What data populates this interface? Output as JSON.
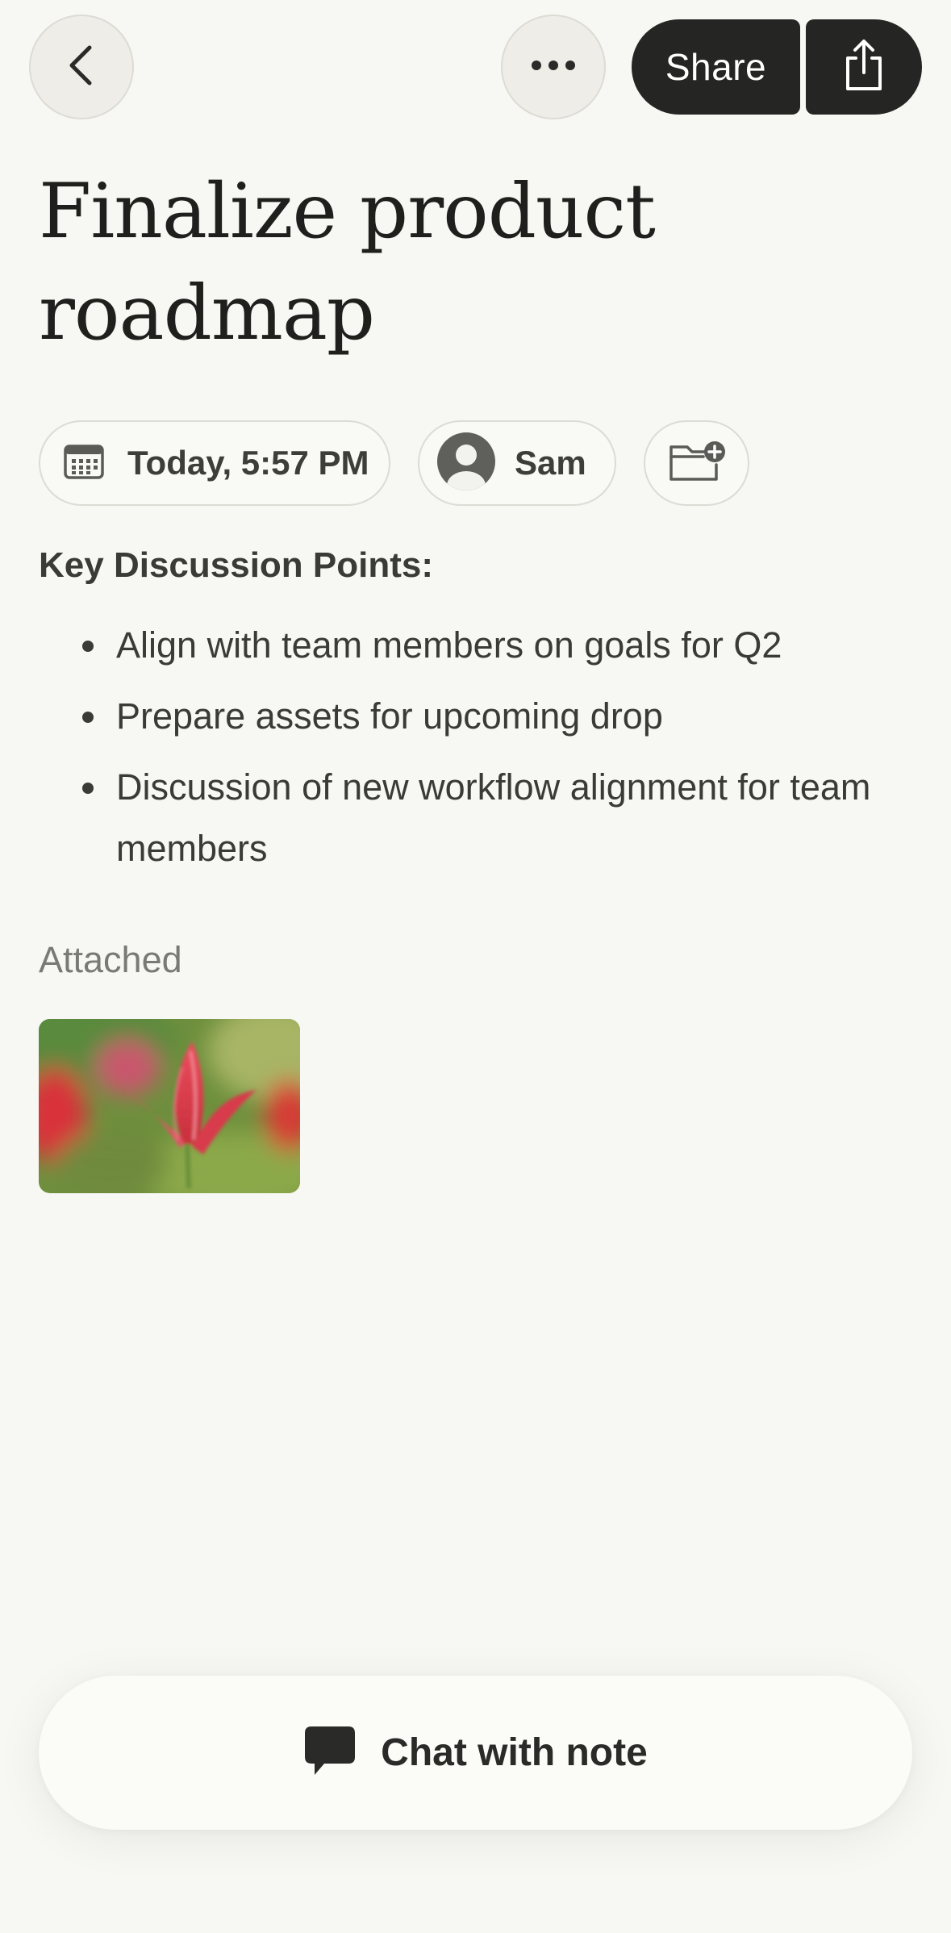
{
  "topbar": {
    "share_label": "Share"
  },
  "note": {
    "title": "Finalize product roadmap",
    "date_chip": "Today, 5:57 PM",
    "user_chip": "Sam",
    "section_heading": "Key Discussion Points:",
    "bullets": [
      "Align with team members on goals for Q2",
      "Prepare assets for upcoming drop",
      "Discussion of new workflow alignment for team members"
    ],
    "attached_label": "Attached"
  },
  "chat": {
    "label": "Chat with note"
  },
  "icons": {
    "back": "chevron-left-icon",
    "more": "ellipsis-icon",
    "export": "share-arrow-icon",
    "date": "calendar-icon",
    "user": "user-avatar-icon",
    "folder": "folder-add-icon",
    "chat": "chat-bubble-icon"
  },
  "colors": {
    "background": "#f7f7f4",
    "dark_button": "#252523",
    "text": "#2a2a28"
  }
}
